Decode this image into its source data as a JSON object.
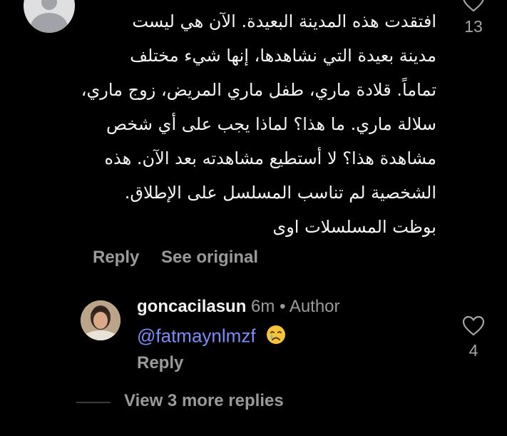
{
  "comment": {
    "lines": [
      "افتقدت هذه المدينة البعيدة. الآن هي ليست",
      "مدينة بعيدة التي نشاهدها، إنها شيء مختلف",
      "تماماً. قلادة ماري، طفل ماري المريض، زوج ماري،",
      "سلالة ماري. ما هذا؟ لماذا يجب على أي شخص",
      "مشاهدة هذا؟ لا أستطيع مشاهدته بعد الآن. هذه",
      "الشخصية لم تناسب المسلسل على الإطلاق.",
      "بوظت المسلسلات اوى"
    ],
    "reply_label": "Reply",
    "see_original_label": "See original",
    "like_count": "13"
  },
  "reply": {
    "username": "goncacilasun",
    "time": "6m",
    "separator": "•",
    "badge": "Author",
    "mention": "@fatmaynlmzf",
    "emoji_icon": "crying-face-emoji",
    "reply_label": "Reply",
    "like_count": "4"
  },
  "view_more_label": "View 3 more replies",
  "colors": {
    "background": "#000000",
    "text": "#f5f5f5",
    "muted": "#9a9a9a",
    "mention": "#7a8cf5"
  }
}
